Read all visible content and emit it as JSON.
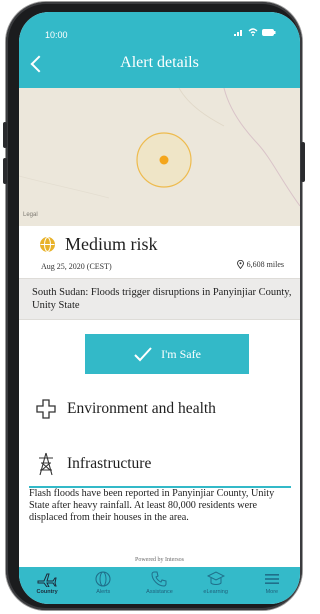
{
  "status_bar": {
    "time": "10:00"
  },
  "header": {
    "title": "Alert details"
  },
  "map": {
    "legal_label": "Legal"
  },
  "alert": {
    "risk_level": "Medium risk",
    "date": "Aug 25, 2020 (CEST)",
    "distance": "6,608 miles",
    "headline": "South Sudan: Floods trigger disruptions in Panyinjiar County, Unity State",
    "safe_button": "I'm Safe",
    "categories": [
      {
        "label": "Environment and health",
        "icon": "cross-outline-icon"
      },
      {
        "label": "Infrastructure",
        "icon": "pylon-icon"
      }
    ],
    "description": "Flash floods have been reported in Panyinjiar County, Unity State after heavy rainfall. At least 80,000 residents were displaced from their houses in the area.",
    "powered_by": "Powered by Intersos"
  },
  "nav": {
    "items": [
      {
        "label": "Country",
        "icon": "plane-icon",
        "active": true
      },
      {
        "label": "Alerts",
        "icon": "alert-globe-icon",
        "active": false
      },
      {
        "label": "Assistance",
        "icon": "phone-icon",
        "active": false
      },
      {
        "label": "eLearning",
        "icon": "graduation-cap-icon",
        "active": false
      },
      {
        "label": "More",
        "icon": "menu-icon",
        "active": false
      }
    ]
  },
  "colors": {
    "accent": "#33b9c8",
    "risk_icon": "#e8b22a",
    "map_bg": "#ece7db",
    "map_marker": "#f4a61c"
  }
}
